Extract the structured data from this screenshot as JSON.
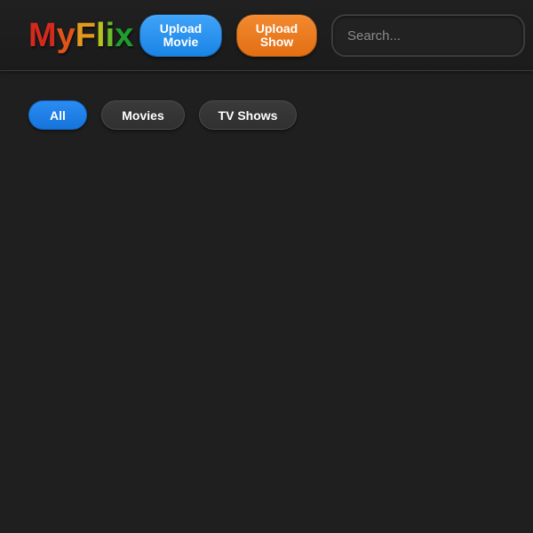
{
  "header": {
    "logo": {
      "letters": [
        {
          "char": "M",
          "color": "#d42a1e"
        },
        {
          "char": "y",
          "color": "#e0541a"
        },
        {
          "char": "F",
          "color": "#e39a1c"
        },
        {
          "char": "l",
          "color": "#b7c21f"
        },
        {
          "char": "i",
          "color": "#6cbb27"
        },
        {
          "char": "x",
          "color": "#1f9e2d"
        }
      ]
    },
    "upload_movie_label": "Upload\nMovie",
    "upload_show_label": "Upload\nShow",
    "search": {
      "placeholder": "Search...",
      "value": ""
    }
  },
  "filters": {
    "all": "All",
    "movies": "Movies",
    "tv_shows": "TV Shows",
    "active": "all"
  },
  "colors": {
    "background": "#1f1f1f",
    "accent_blue": "#1a84e6",
    "accent_orange": "#e36f14",
    "inactive_pill": "#333333"
  }
}
